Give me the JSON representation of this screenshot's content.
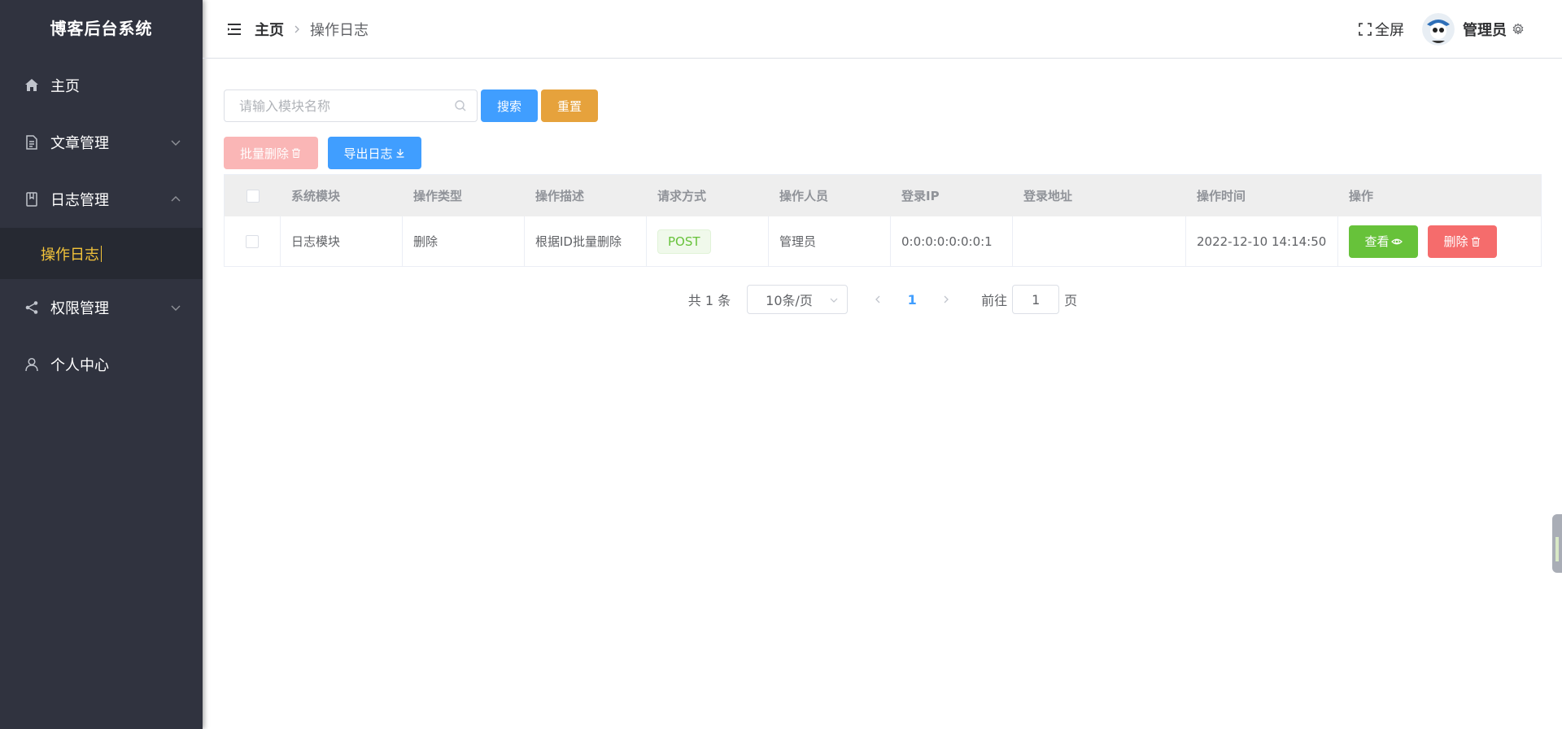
{
  "app": {
    "brand": "博客后台系统"
  },
  "sidebar": {
    "items": [
      {
        "label": "主页",
        "icon": "home-icon"
      },
      {
        "label": "文章管理",
        "icon": "document-icon",
        "expanded": false
      },
      {
        "label": "日志管理",
        "icon": "log-book-icon",
        "expanded": true,
        "children": [
          {
            "label": "操作日志",
            "active": true
          }
        ]
      },
      {
        "label": "权限管理",
        "icon": "share-icon",
        "expanded": false
      },
      {
        "label": "个人中心",
        "icon": "user-icon"
      }
    ]
  },
  "header": {
    "breadcrumb": {
      "home": "主页",
      "current": "操作日志"
    },
    "fullscreen_label": "全屏",
    "username": "管理员"
  },
  "toolbar": {
    "search_placeholder": "请输入模块名称",
    "search_label": "搜索",
    "reset_label": "重置",
    "batch_delete_label": "批量删除",
    "export_label": "导出日志"
  },
  "table": {
    "columns": [
      "系统模块",
      "操作类型",
      "操作描述",
      "请求方式",
      "操作人员",
      "登录IP",
      "登录地址",
      "操作时间",
      "操作"
    ],
    "rows": [
      {
        "module": "日志模块",
        "type": "删除",
        "description": "根据ID批量删除",
        "method": "POST",
        "operator": "管理员",
        "ip": "0:0:0:0:0:0:0:1",
        "location": "",
        "time": "2022-12-10 14:14:50",
        "view_label": "查看",
        "delete_label": "删除"
      }
    ]
  },
  "pagination": {
    "total_text": "共 1 条",
    "page_size": "10条/页",
    "current_page": "1",
    "goto_prefix": "前往",
    "goto_value": "1",
    "goto_suffix": "页"
  },
  "colors": {
    "sidebar_bg": "#30333f",
    "active_menu": "#f4c43a",
    "primary": "#409eff",
    "warning": "#e6a23c",
    "success": "#67c23a",
    "danger": "#f56c6c"
  }
}
